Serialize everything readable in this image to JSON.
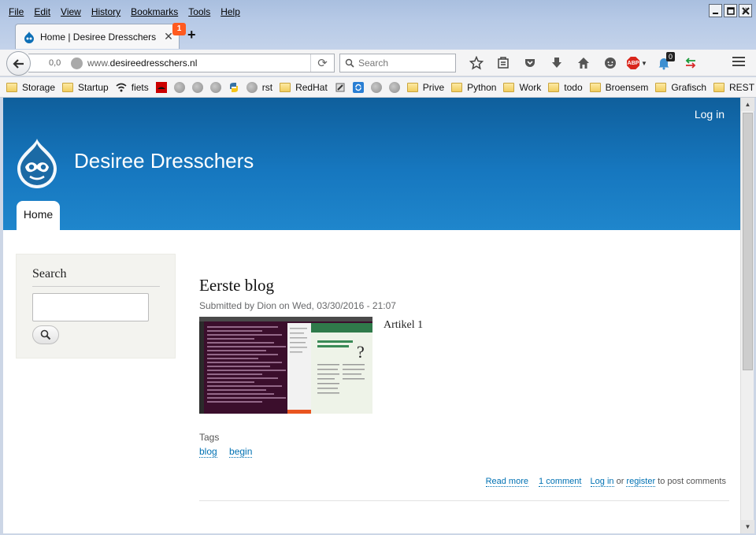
{
  "window": {
    "menu": [
      "File",
      "Edit",
      "View",
      "History",
      "Bookmarks",
      "Tools",
      "Help"
    ],
    "controls": [
      "minimize",
      "maximize",
      "close"
    ]
  },
  "tab": {
    "title": "Home | Desiree Dresschers",
    "badge": "1",
    "close_icon": "close-icon",
    "new_tab": "+"
  },
  "nav": {
    "extension_text": "0,0",
    "url_prefix": "www.",
    "url_domain": "desireedresschers.nl",
    "search_placeholder": "Search",
    "notification_count": "0"
  },
  "bookmarks": [
    {
      "label": "Storage",
      "icon": "folder"
    },
    {
      "label": "Startup",
      "icon": "folder"
    },
    {
      "label": "fiets",
      "icon": "wifi"
    },
    {
      "label": "",
      "icon": "redhat"
    },
    {
      "label": "",
      "icon": "globe"
    },
    {
      "label": "",
      "icon": "globe"
    },
    {
      "label": "",
      "icon": "globe"
    },
    {
      "label": "",
      "icon": "python"
    },
    {
      "label": "rst",
      "icon": "globe"
    },
    {
      "label": "RedHat",
      "icon": "folder"
    },
    {
      "label": "",
      "icon": "tool"
    },
    {
      "label": "",
      "icon": "sync"
    },
    {
      "label": "",
      "icon": "globe"
    },
    {
      "label": "",
      "icon": "globe"
    },
    {
      "label": "Prive",
      "icon": "folder"
    },
    {
      "label": "Python",
      "icon": "folder"
    },
    {
      "label": "Work",
      "icon": "folder"
    },
    {
      "label": "todo",
      "icon": "folder"
    },
    {
      "label": "Broensem",
      "icon": "folder"
    },
    {
      "label": "Grafisch",
      "icon": "folder"
    },
    {
      "label": "REST",
      "icon": "folder"
    }
  ],
  "bookmarks_more": "»",
  "site": {
    "login": "Log in",
    "name": "Desiree Dresschers",
    "home_tab": "Home"
  },
  "sidebar": {
    "search_title": "Search"
  },
  "article": {
    "title": "Eerste blog",
    "meta": "Submitted by Dion on Wed, 03/30/2016 - 21:07",
    "body": "Artikel 1",
    "tags_label": "Tags",
    "tags": [
      "blog",
      "begin"
    ],
    "read_more": "Read more",
    "comments": "1 comment",
    "login_link": "Log in",
    "or_text": "or",
    "register_link": "register",
    "post_text": "to post comments"
  },
  "colors": {
    "header_blue": "#1677bf",
    "link_blue": "#0071b3",
    "tab_badge": "#ff5a1f"
  }
}
